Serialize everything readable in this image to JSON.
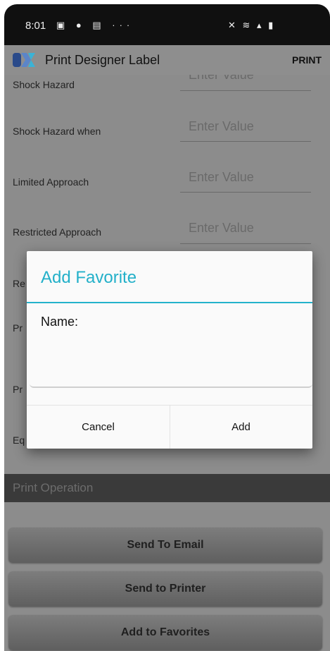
{
  "status_bar": {
    "time": "8:01",
    "left_icons": "▣ ● ▤ ···",
    "right_icons": "✕ ≋ ▴ ▮"
  },
  "app_bar": {
    "title": "Print Designer Label",
    "action": "PRINT"
  },
  "form": {
    "rows": [
      {
        "label": "Shock Hazard",
        "placeholder": "Enter Value"
      },
      {
        "label": "Shock Hazard when",
        "placeholder": "Enter Value"
      },
      {
        "label": "Limited Approach",
        "placeholder": "Enter Value"
      },
      {
        "label": "Restricted Approach",
        "placeholder": "Enter Value"
      },
      {
        "label": "Re"
      },
      {
        "label": "Pr"
      },
      {
        "label": "Pr"
      },
      {
        "label": "Eq"
      }
    ]
  },
  "section": {
    "title": "Print Operation"
  },
  "buttons": {
    "email": "Send To Email",
    "printer": "Send to Printer",
    "favorites": "Add to Favorites"
  },
  "dialog": {
    "title": "Add Favorite",
    "name_label": "Name:",
    "name_value": "",
    "cancel": "Cancel",
    "add": "Add"
  },
  "colors": {
    "accent": "#23b0c9",
    "scrim": "#8c8c8c",
    "status_bar": "#101010"
  }
}
